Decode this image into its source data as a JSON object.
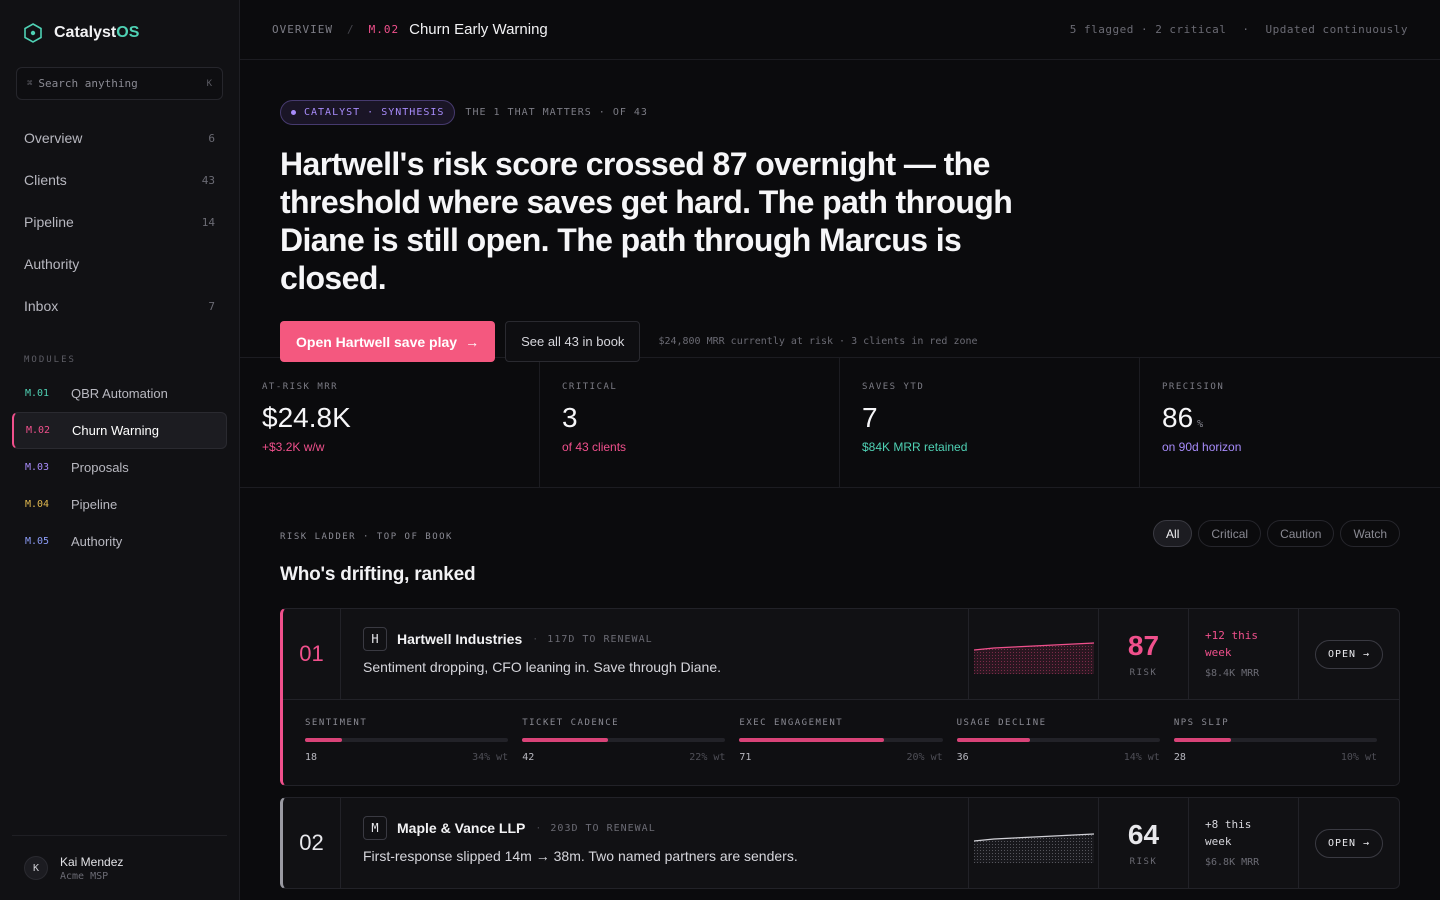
{
  "brand": {
    "name_a": "Catalyst",
    "name_b": "OS"
  },
  "search": {
    "key_hint_left": "⌘",
    "placeholder": "Search anything",
    "key_hint_right": "K"
  },
  "nav": [
    {
      "label": "Overview",
      "count": "6"
    },
    {
      "label": "Clients",
      "count": "43"
    },
    {
      "label": "Pipeline",
      "count": "14"
    },
    {
      "label": "Authority",
      "count": ""
    },
    {
      "label": "Inbox",
      "count": "7"
    }
  ],
  "modules_label": "MODULES",
  "modules": [
    {
      "code": "M.01",
      "label": "QBR Automation",
      "color": "#4fd1b4"
    },
    {
      "code": "M.02",
      "label": "Churn Warning",
      "color": "#f0508c"
    },
    {
      "code": "M.03",
      "label": "Proposals",
      "color": "#a78bfa"
    },
    {
      "code": "M.04",
      "label": "Pipeline",
      "color": "#e0b84f"
    },
    {
      "code": "M.05",
      "label": "Authority",
      "color": "#8b9cf6"
    }
  ],
  "user": {
    "initial": "K",
    "name": "Kai Mendez",
    "org": "Acme MSP"
  },
  "topbar": {
    "crumb_root": "OVERVIEW",
    "crumb_sep": "/",
    "crumb_code": "M.02",
    "crumb_title": "Churn Early Warning",
    "flagged": "5 flagged · 2 critical",
    "sep": "·",
    "updated": "Updated continuously"
  },
  "hero": {
    "pill": "CATALYST · SYNTHESIS",
    "pill_note": "THE 1 THAT MATTERS · OF 43",
    "headline": "Hartwell's risk score crossed 87 overnight — the threshold where saves get hard. The path through Diane is still open. The path through Marcus is closed.",
    "primary_btn": "Open Hartwell save play",
    "primary_arrow": "→",
    "secondary_btn": "See all 43 in book",
    "note": "$24,800 MRR currently at risk · 3 clients in red zone"
  },
  "stats": [
    {
      "label": "AT-RISK MRR",
      "value": "$24.8K",
      "unit": "",
      "sub": "+$3.2K w/w",
      "sub_color": "#f0508c"
    },
    {
      "label": "CRITICAL",
      "value": "3",
      "unit": "",
      "sub": "of 43 clients",
      "sub_color": "#f0508c"
    },
    {
      "label": "SAVES YTD",
      "value": "7",
      "unit": "",
      "sub": "$84K MRR retained",
      "sub_color": "#4fd1b4"
    },
    {
      "label": "PRECISION",
      "value": "86",
      "unit": "%",
      "sub": "on 90d horizon",
      "sub_color": "#a78bfa"
    }
  ],
  "ladder": {
    "label": "RISK LADDER · TOP OF BOOK",
    "title": "Who's drifting, ranked",
    "filters": [
      "All",
      "Critical",
      "Caution",
      "Watch"
    ]
  },
  "clients": [
    {
      "rank": "01",
      "initial": "H",
      "name": "Hartwell Industries",
      "renewal": "117D TO RENEWAL",
      "desc": "Sentiment dropping, CFO leaning in. Save through Diane.",
      "score": "87",
      "score_label": "RISK",
      "delta": "+12 this week",
      "mrr": "$8.4K MRR",
      "open": "OPEN →",
      "signals": [
        {
          "label": "SENTIMENT",
          "value": "18",
          "weight": "34% wt",
          "level": 0.18
        },
        {
          "label": "TICKET CADENCE",
          "value": "42",
          "weight": "22% wt",
          "level": 0.42
        },
        {
          "label": "EXEC ENGAGEMENT",
          "value": "71",
          "weight": "20% wt",
          "level": 0.71
        },
        {
          "label": "USAGE DECLINE",
          "value": "36",
          "weight": "14% wt",
          "level": 0.36
        },
        {
          "label": "NPS SLIP",
          "value": "28",
          "weight": "10% wt",
          "level": 0.28
        }
      ]
    },
    {
      "rank": "02",
      "initial": "M",
      "name": "Maple & Vance LLP",
      "renewal": "203D TO RENEWAL",
      "desc": "First-response slipped 14m → 38m. Two named partners are senders.",
      "score": "64",
      "score_label": "RISK",
      "delta": "+8 this week",
      "mrr": "$6.8K MRR",
      "open": "OPEN →"
    }
  ],
  "colors": {
    "accent": "#f0508c",
    "teal": "#4fd1b4",
    "violet": "#a78bfa"
  }
}
